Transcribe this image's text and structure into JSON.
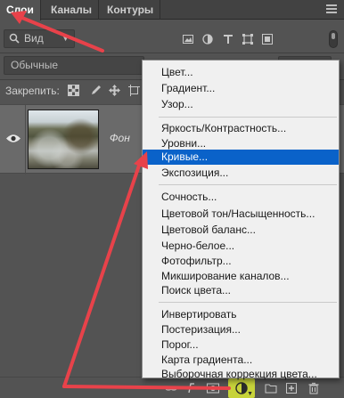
{
  "tabs": [
    {
      "label": "Слои",
      "active": true
    },
    {
      "label": "Каналы",
      "active": false
    },
    {
      "label": "Контуры",
      "active": false
    }
  ],
  "filter": {
    "kind_value": "Вид",
    "icons": [
      "image-filter-icon",
      "adjustment-filter-icon",
      "type-filter-icon",
      "shape-filter-icon",
      "smart-object-filter-icon"
    ]
  },
  "blend": {
    "value": "Обычные"
  },
  "lock": {
    "label": "Закрепить:"
  },
  "layer": {
    "name": "Фон",
    "visible": true
  },
  "adjustment_menu": {
    "groups": [
      [
        "Цвет...",
        "Градиент...",
        "Узор..."
      ],
      [
        "Яркость/Контрастность...",
        "Уровни...",
        "Кривые...",
        "Экспозиция..."
      ],
      [
        "Сочность...",
        "Цветовой тон/Насыщенность...",
        "Цветовой баланс...",
        "Черно-белое...",
        "Фотофильтр...",
        "Микширование каналов...",
        "Поиск цвета..."
      ],
      [
        "Инвертировать",
        "Постеризация...",
        "Порог...",
        "Карта градиента...",
        "Выборочная коррекция цвета..."
      ]
    ],
    "highlighted_item": "Кривые..."
  },
  "colors": {
    "panel_bg": "#535353",
    "tab_bar_bg": "#424242",
    "menu_bg": "#f0f0f0",
    "menu_highlight": "#0a62c9",
    "annotation_arrow": "#e8424a",
    "adjustment_button_highlight": "#c7d33a"
  }
}
